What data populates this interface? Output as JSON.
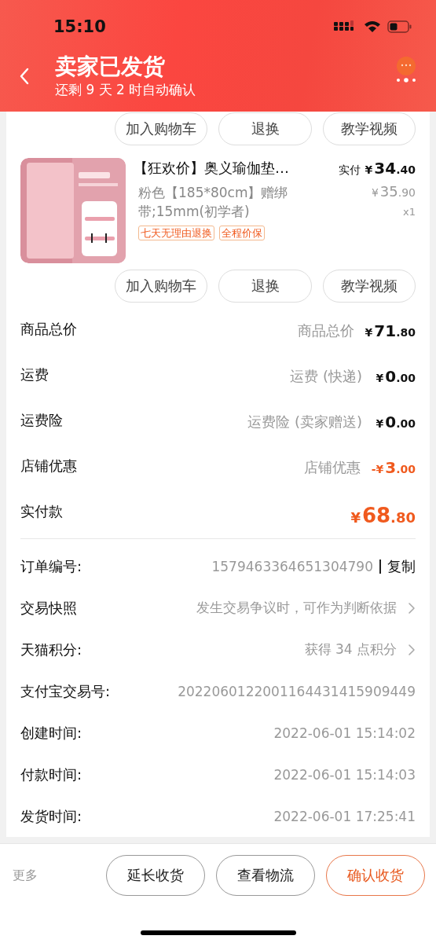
{
  "status_bar": {
    "time": "15:10"
  },
  "header": {
    "title": "卖家已发货",
    "subtitle": "还剩 9 天 2 时自动确认"
  },
  "top_actions": [
    "加入购物车",
    "退换",
    "教学视频"
  ],
  "item": {
    "image": {
      "kind": "picture"
    },
    "title": "【狂欢价】奥义瑜伽垫…",
    "paid_label": "实付",
    "paid_price": "¥34.40",
    "spec": "粉色【185*80cm】赠绑带;15mm(初学者)",
    "original_price": "¥35.90",
    "quantity": "x1",
    "tags": [
      "七天无理由退换",
      "全程价保"
    ],
    "actions": [
      "加入购物车",
      "退换",
      "教学视频"
    ]
  },
  "fees": [
    {
      "kind": "normal",
      "label": "商品总价",
      "detail": "商品总价",
      "amount": "¥71.80"
    },
    {
      "kind": "normal",
      "label": "运费",
      "detail": "运费 (快递)",
      "amount": "¥0.00"
    },
    {
      "kind": "normal",
      "label": "运费险",
      "detail": "运费险 (卖家赠送)",
      "amount": "¥0.00"
    },
    {
      "kind": "discount",
      "label": "店铺优惠",
      "detail": "店铺优惠",
      "amount": "-¥3.00"
    },
    {
      "kind": "total",
      "label": "实付款",
      "amount": "¥68.80"
    }
  ],
  "order_info": [
    {
      "label": "订单编号:",
      "value": "1579463364651304790",
      "action": "复制",
      "chevron": false
    },
    {
      "label": "交易快照",
      "value": "发生交易争议时，可作为判断依据",
      "chevron": true
    },
    {
      "label": "天猫积分:",
      "value": "获得 34 点积分",
      "chevron": true
    },
    {
      "label": "支付宝交易号:",
      "value": "2022060122001164431415909449",
      "chevron": false
    },
    {
      "label": "创建时间:",
      "value": "2022-06-01 15:14:02",
      "chevron": false
    },
    {
      "label": "付款时间:",
      "value": "2022-06-01 15:14:03",
      "chevron": false
    },
    {
      "label": "发货时间:",
      "value": "2022-06-01 17:25:41",
      "chevron": false
    }
  ],
  "bottom_bar": {
    "more": "更多",
    "buttons": [
      {
        "label": "延长收货",
        "primary": false
      },
      {
        "label": "查看物流",
        "primary": false
      },
      {
        "label": "确认收货",
        "primary": true
      }
    ]
  }
}
